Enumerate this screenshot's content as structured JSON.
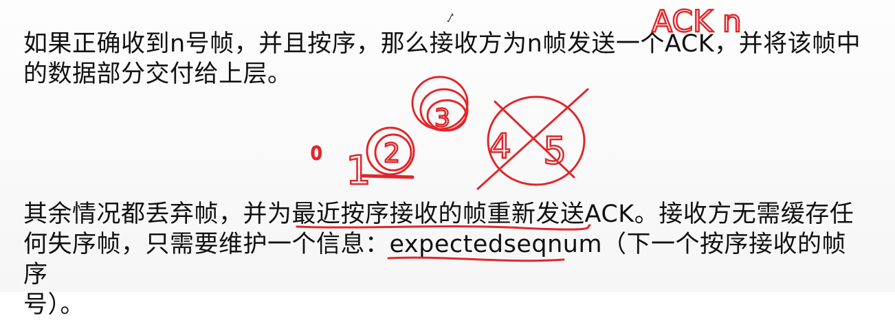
{
  "paragraph_1": {
    "line_1": "如果正确收到n号帧，并且按序，那么接收方为n帧发送一个ACK，并将该帧中",
    "line_2": "的数据部分交付给上层。"
  },
  "paragraph_2": {
    "line_1": "其余情况都丢弃帧，并为最近按序接收的帧重新发送ACK。接收方无需缓存任",
    "line_2": "何失序帧，只需要维护一个信息：expectedseqnum（下一个按序接收的帧序",
    "line_3": "号）。"
  },
  "annotations": {
    "ack_note": "ACK n",
    "frame_0": "0",
    "frame_1": "1",
    "frame_2": "2",
    "frame_3": "3",
    "frame_4": "4",
    "frame_5": "5",
    "ink_color": "#e0262a"
  }
}
